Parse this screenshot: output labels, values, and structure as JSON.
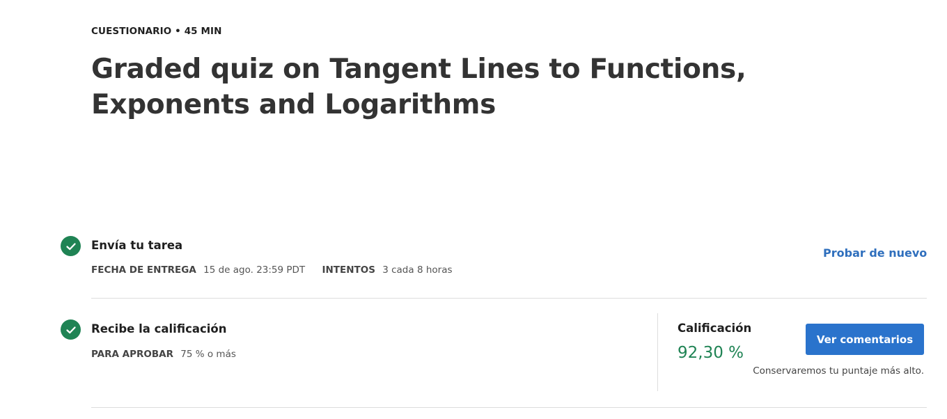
{
  "header": {
    "eyebrow": "CUESTIONARIO • 45 MIN",
    "title": "Graded quiz on Tangent Lines to Functions, Exponents and Logarithms"
  },
  "submit_step": {
    "title": "Envía tu tarea",
    "due_label": "FECHA DE ENTREGA",
    "due_value": "15 de ago. 23:59 PDT",
    "attempts_label": "INTENTOS",
    "attempts_value": "3 cada 8 horas",
    "retry_label": "Probar de nuevo"
  },
  "grade_step": {
    "title": "Recibe la calificación",
    "pass_label": "PARA APROBAR",
    "pass_value": "75 % o más",
    "grade_label": "Calificación",
    "grade_value": "92,30 %",
    "feedback_button": "Ver comentarios",
    "note": "Conservaremos tu puntaje más alto."
  },
  "colors": {
    "success": "#1f8354",
    "accent": "#2a73cc",
    "link": "#2f6fbd"
  },
  "icons": {
    "status": "check-circle-icon"
  }
}
